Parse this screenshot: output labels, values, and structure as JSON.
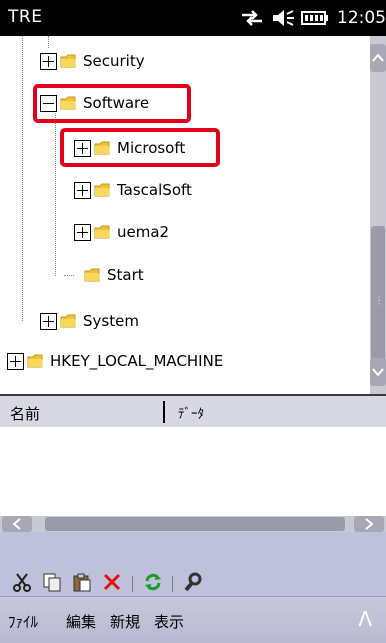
{
  "statusbar": {
    "app_title": "TRE",
    "time": "12:05",
    "icons": [
      "connectivity-icon",
      "speaker-icon",
      "battery-icon"
    ]
  },
  "tree": {
    "items": [
      {
        "label": "Security",
        "expander": "plus",
        "highlighted": false
      },
      {
        "label": "Software",
        "expander": "minus",
        "highlighted": true
      },
      {
        "label": "Microsoft",
        "expander": "plus",
        "highlighted": true
      },
      {
        "label": "TascalSoft",
        "expander": "plus",
        "highlighted": false
      },
      {
        "label": "uema2",
        "expander": "plus",
        "highlighted": false
      },
      {
        "label": "Start",
        "expander": "none",
        "highlighted": false
      },
      {
        "label": "System",
        "expander": "plus",
        "highlighted": false
      },
      {
        "label": "HKEY_LOCAL_MACHINE",
        "expander": "plus",
        "highlighted": false
      }
    ]
  },
  "list": {
    "columns": [
      "名前",
      "ﾃﾞｰﾀ"
    ]
  },
  "toolbar": {
    "icons": [
      "cut-icon",
      "copy-icon",
      "paste-icon",
      "delete-icon",
      "refresh-icon",
      "search-icon"
    ]
  },
  "menubar": {
    "items": [
      "ﾌｧｲﾙ",
      "編集",
      "新規",
      "表示"
    ],
    "caret": "Λ"
  },
  "colors": {
    "highlight": "#e3001b",
    "toolbar_bg": "#bfc0da",
    "folder": "#f0c23a"
  }
}
